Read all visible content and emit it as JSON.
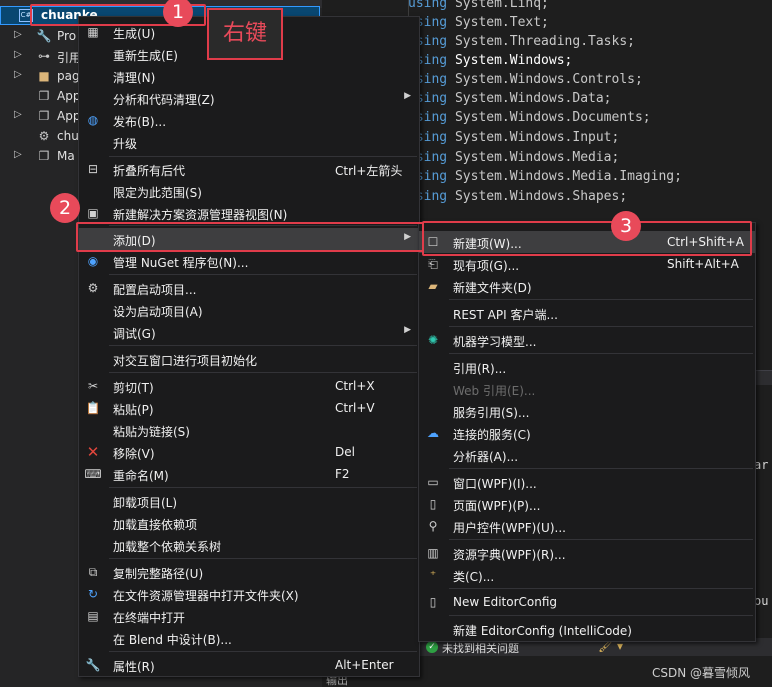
{
  "solution_explorer": {
    "project_name": "chuanke...",
    "tree": [
      {
        "label": "Pro",
        "icon": "wrench-icon"
      },
      {
        "label": "引用",
        "icon": "references-icon"
      },
      {
        "label": "pag",
        "icon": "folder-icon"
      },
      {
        "label": "App",
        "icon": "xaml-file-icon"
      },
      {
        "label": "App",
        "icon": "xaml-file-icon"
      },
      {
        "label": "chu",
        "icon": "settings-file-icon"
      },
      {
        "label": "Ma",
        "icon": "xaml-file-icon"
      }
    ]
  },
  "code_lines": [
    {
      "kw": "using",
      "ns": "System.Linq;"
    },
    {
      "kw": "using",
      "ns": "System.Text;"
    },
    {
      "kw": "using",
      "ns": "System.Threading.Tasks;"
    },
    {
      "kw": "using",
      "ns": "System.Windows;"
    },
    {
      "kw": "using",
      "ns": "System.Windows.Controls;"
    },
    {
      "kw": "using",
      "ns": "System.Windows.Data;"
    },
    {
      "kw": "using",
      "ns": "System.Windows.Documents;"
    },
    {
      "kw": "using",
      "ns": "System.Windows.Input;"
    },
    {
      "kw": "using",
      "ns": "System.Windows.Media;"
    },
    {
      "kw": "using",
      "ns": "System.Windows.Media.Imaging;"
    },
    {
      "kw": "using",
      "ns": "System.Windows.Shapes;"
    }
  ],
  "context_menu": {
    "items": [
      {
        "label": "生成(U)",
        "shortcut": "",
        "icon": "build-icon"
      },
      {
        "label": "重新生成(E)",
        "shortcut": "",
        "icon": ""
      },
      {
        "label": "清理(N)",
        "shortcut": "",
        "icon": ""
      },
      {
        "label": "分析和代码清理(Z)",
        "shortcut": "",
        "icon": ""
      },
      {
        "label": "发布(B)...",
        "shortcut": "",
        "icon": "globe-icon"
      },
      {
        "label": "升级",
        "shortcut": "",
        "icon": ""
      },
      {
        "label": "折叠所有后代",
        "shortcut": "Ctrl+左箭头",
        "icon": "collapse-icon"
      },
      {
        "label": "限定为此范围(S)",
        "shortcut": "",
        "icon": ""
      },
      {
        "label": "新建解决方案资源管理器视图(N)",
        "shortcut": "",
        "icon": "new-view-icon"
      },
      {
        "label": "添加(D)",
        "shortcut": "",
        "icon": ""
      },
      {
        "label": "管理 NuGet 程序包(N)...",
        "shortcut": "",
        "icon": "nuget-icon"
      },
      {
        "label": "配置启动项目...",
        "shortcut": "",
        "icon": "gear-icon"
      },
      {
        "label": "设为启动项目(A)",
        "shortcut": "",
        "icon": ""
      },
      {
        "label": "调试(G)",
        "shortcut": "",
        "icon": ""
      },
      {
        "label": "对交互窗口进行项目初始化",
        "shortcut": "",
        "icon": ""
      },
      {
        "label": "剪切(T)",
        "shortcut": "Ctrl+X",
        "icon": "scissors-icon"
      },
      {
        "label": "粘贴(P)",
        "shortcut": "Ctrl+V",
        "icon": "paste-icon"
      },
      {
        "label": "粘贴为链接(S)",
        "shortcut": "",
        "icon": ""
      },
      {
        "label": "移除(V)",
        "shortcut": "Del",
        "icon": "delete-x-icon"
      },
      {
        "label": "重命名(M)",
        "shortcut": "F2",
        "icon": "rename-icon"
      },
      {
        "label": "卸载项目(L)",
        "shortcut": "",
        "icon": ""
      },
      {
        "label": "加载直接依赖项",
        "shortcut": "",
        "icon": ""
      },
      {
        "label": "加载整个依赖关系树",
        "shortcut": "",
        "icon": ""
      },
      {
        "label": "复制完整路径(U)",
        "shortcut": "",
        "icon": "copy-icon"
      },
      {
        "label": "在文件资源管理器中打开文件夹(X)",
        "shortcut": "",
        "icon": "open-folder-icon"
      },
      {
        "label": "在终端中打开",
        "shortcut": "",
        "icon": "terminal-icon"
      },
      {
        "label": "在 Blend 中设计(B)...",
        "shortcut": "",
        "icon": ""
      },
      {
        "label": "属性(R)",
        "shortcut": "Alt+Enter",
        "icon": "wrench-icon"
      }
    ]
  },
  "add_submenu": {
    "items": [
      {
        "label": "新建项(W)...",
        "shortcut": "Ctrl+Shift+A",
        "icon": "new-item-icon"
      },
      {
        "label": "现有项(G)...",
        "shortcut": "Shift+Alt+A",
        "icon": "existing-item-icon"
      },
      {
        "label": "新建文件夹(D)",
        "shortcut": "",
        "icon": "new-folder-icon"
      },
      {
        "label": "REST API 客户端...",
        "shortcut": "",
        "icon": ""
      },
      {
        "label": "机器学习模型...",
        "shortcut": "",
        "icon": "ml-model-icon"
      },
      {
        "label": "引用(R)...",
        "shortcut": "",
        "icon": ""
      },
      {
        "label": "Web 引用(E)...",
        "shortcut": "",
        "icon": ""
      },
      {
        "label": "服务引用(S)...",
        "shortcut": "",
        "icon": ""
      },
      {
        "label": "连接的服务(C)",
        "shortcut": "",
        "icon": "connected-service-icon"
      },
      {
        "label": "分析器(A)...",
        "shortcut": "",
        "icon": ""
      },
      {
        "label": "窗口(WPF)(I)...",
        "shortcut": "",
        "icon": "window-icon"
      },
      {
        "label": "页面(WPF)(P)...",
        "shortcut": "",
        "icon": "page-icon"
      },
      {
        "label": "用户控件(WPF)(U)...",
        "shortcut": "",
        "icon": "user-control-icon"
      },
      {
        "label": "资源字典(WPF)(R)...",
        "shortcut": "",
        "icon": "resource-dict-icon"
      },
      {
        "label": "类(C)...",
        "shortcut": "",
        "icon": "class-icon"
      },
      {
        "label": "New EditorConfig",
        "shortcut": "",
        "icon": "file-icon"
      },
      {
        "label": "新建 EditorConfig (IntelliCode)",
        "shortcut": "",
        "icon": ""
      }
    ]
  },
  "annotations": {
    "badge1": "1",
    "badge2": "2",
    "badge3": "3",
    "callout": "右键"
  },
  "status": {
    "text": "未找到相关问题",
    "output_tab": "输出"
  },
  "edge_code": {
    "a": "ar",
    "b": "ou"
  },
  "watermark": "CSDN @暮雪倾风",
  "colors": {
    "accent_red": "#e03c4a",
    "keyword": "#569cd6",
    "menu_bg": "#1b1b1c",
    "highlight": "#3e3e40"
  }
}
